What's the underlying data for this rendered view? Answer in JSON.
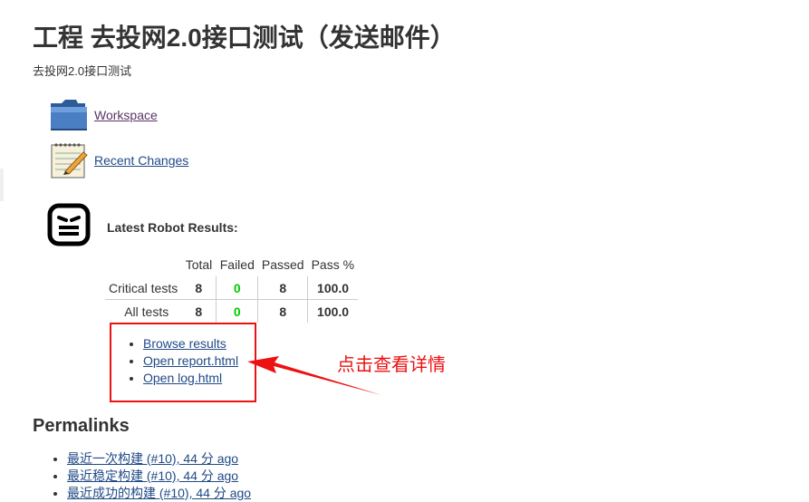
{
  "page": {
    "title": "工程 去投网2.0接口测试（发送邮件）",
    "description": "去投网2.0接口测试"
  },
  "tasks": [
    {
      "label": "Workspace",
      "icon": "folder-icon"
    },
    {
      "label": "Recent Changes",
      "icon": "notepad-icon"
    }
  ],
  "robot": {
    "heading": "Latest Robot Results:",
    "columns": [
      "",
      "Total",
      "Failed",
      "Passed",
      "Pass %"
    ],
    "rows": [
      {
        "label": "Critical tests",
        "total": "8",
        "failed": "0",
        "passed": "8",
        "pass_pct": "100.0"
      },
      {
        "label": "All tests",
        "total": "8",
        "failed": "0",
        "passed": "8",
        "pass_pct": "100.0"
      }
    ],
    "links": [
      "Browse results",
      "Open report.html",
      "Open log.html"
    ]
  },
  "annotation": {
    "text": "点击查看详情",
    "color": "#ee1111"
  },
  "permalinks": {
    "heading": "Permalinks",
    "items": [
      "最近一次构建 (#10), 44 分 ago",
      "最近稳定构建 (#10), 44 分 ago",
      "最近成功的构建 (#10), 44 分 ago"
    ]
  },
  "colors": {
    "link": "#204a87",
    "visited_link": "#5c3566",
    "failed_zero": "#00cc00",
    "text": "#333333"
  }
}
